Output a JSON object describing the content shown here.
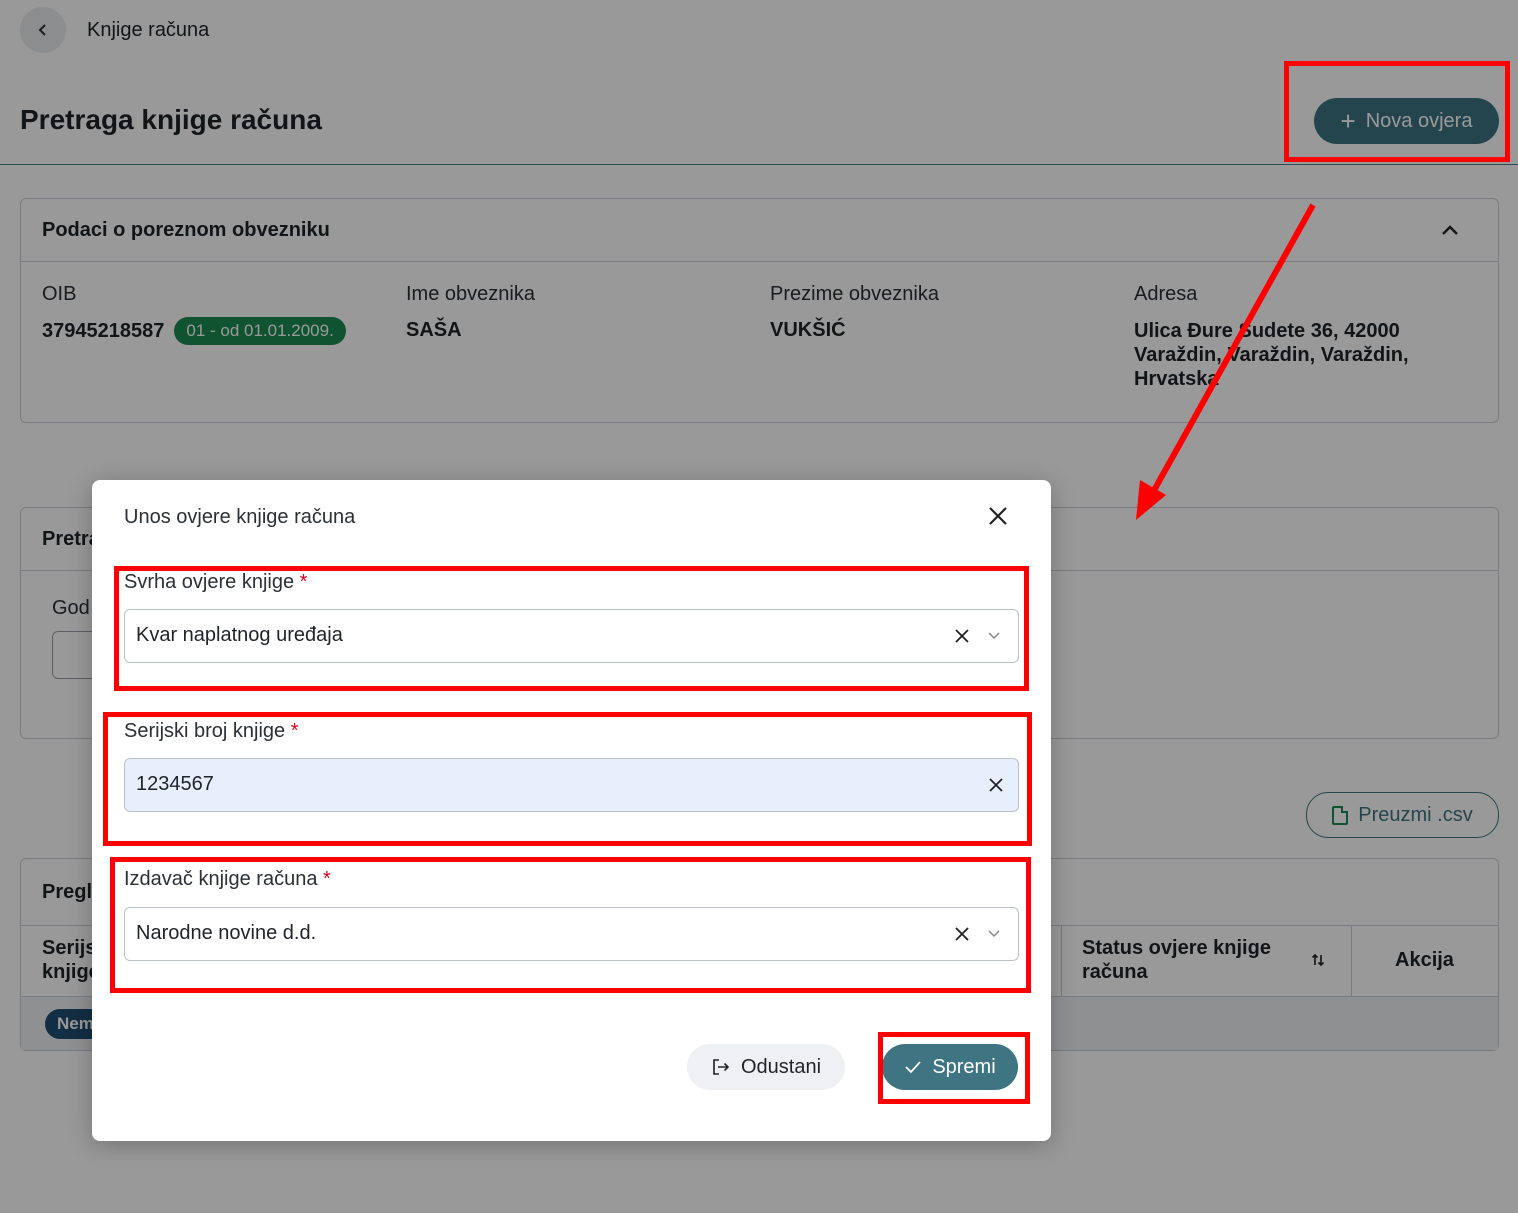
{
  "breadcrumb": {
    "back_icon": "chevron-left-icon",
    "label": "Knjige računa"
  },
  "page": {
    "title": "Pretraga knjige računa",
    "new_button": "Nova ovjera",
    "new_icon": "plus-icon"
  },
  "taxpayer": {
    "section_title": "Podaci o poreznom obvezniku",
    "oib_label": "OIB",
    "oib_value": "37945218587",
    "oib_badge": "01 - od 01.01.2009.",
    "first_name_label": "Ime obveznika",
    "first_name_value": "SAŠA",
    "last_name_label": "Prezime obveznika",
    "last_name_value": "VUKŠIĆ",
    "address_label": "Adresa",
    "address_lines": [
      "Ulica Đure Sudete 36, 42000",
      "Varaždin, Varaždin, Varaždin,",
      "Hrvatska"
    ]
  },
  "search": {
    "section_title_partial": "Pretra",
    "year_label_partial": "God"
  },
  "download_csv": "Preuzmi .csv",
  "overview": {
    "section_title_partial": "Pregl",
    "col_serial_partial_1": "Serijs",
    "col_serial_partial_2": "knjige",
    "col_status_1": "Status ovjere knjige",
    "col_status_2": "računa",
    "col_action": "Akcija",
    "row_badge_partial": "Nem"
  },
  "modal": {
    "title": "Unos ovjere knjige računa",
    "purpose_label": "Svrha ovjere knjige",
    "purpose_value": "Kvar naplatnog uređaja",
    "serial_label": "Serijski broj knjige",
    "serial_value": "1234567",
    "issuer_label": "Izdavač knjige računa",
    "issuer_value": "Narodne novine d.d.",
    "required_mark": "*",
    "cancel": "Odustani",
    "save": "Spremi"
  },
  "colors": {
    "accent": "#3f7482",
    "badge_green": "#1b8a53",
    "annotation_red": "#ff0000",
    "required_red": "#e0001b"
  }
}
